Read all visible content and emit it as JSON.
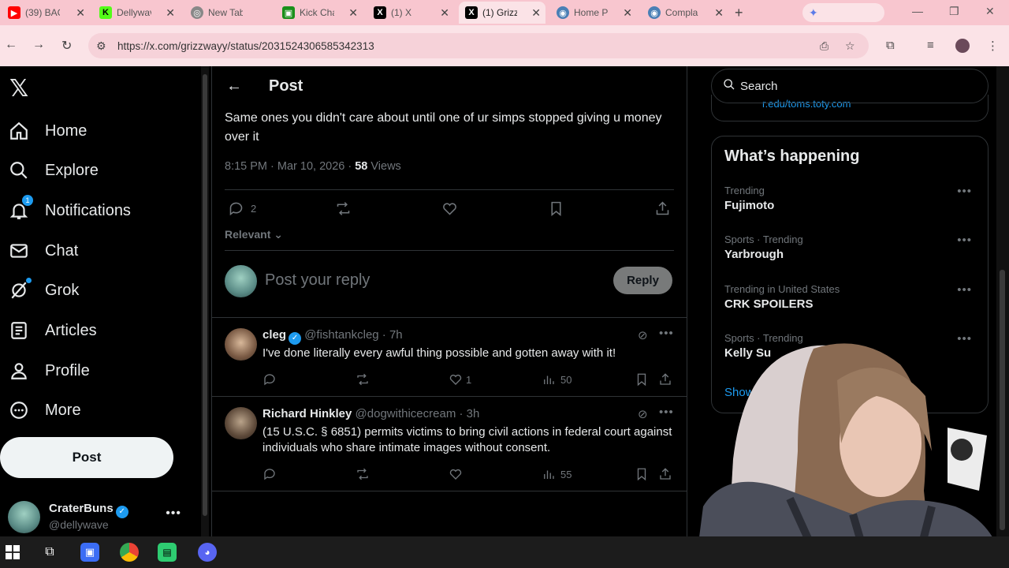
{
  "browser": {
    "tabs": [
      {
        "title": "(39) BAG",
        "color": "#ff0000",
        "glyph": "▶",
        "icon": "youtube-icon"
      },
      {
        "title": "Dellywave",
        "color": "#53fc18",
        "glyph": "K",
        "icon": "kick-icon"
      },
      {
        "title": "New Tab",
        "color": "#888888",
        "glyph": "◎",
        "icon": "chrome-icon"
      },
      {
        "title": "Kick Chat",
        "color": "#1a8f1a",
        "glyph": "▣",
        "icon": "kick-chat-icon"
      },
      {
        "title": "(1) X",
        "color": "#000000",
        "glyph": "X",
        "icon": "x-icon"
      },
      {
        "title": "(1) Grizz",
        "color": "#000000",
        "glyph": "X",
        "icon": "x-icon"
      },
      {
        "title": "Home P",
        "color": "#4a7fb5",
        "glyph": "◉",
        "icon": "globe-icon"
      },
      {
        "title": "Compla",
        "color": "#4a7fb5",
        "glyph": "◉",
        "icon": "globe-icon"
      }
    ],
    "url": "https://x.com/grizzwayy/status/2031524306585342313"
  },
  "nav": {
    "items": [
      {
        "label": "Home",
        "icon": "home-icon"
      },
      {
        "label": "Explore",
        "icon": "search-icon"
      },
      {
        "label": "Notifications",
        "icon": "bell-icon",
        "badge": "1"
      },
      {
        "label": "Chat",
        "icon": "mail-icon"
      },
      {
        "label": "Grok",
        "icon": "grok-icon"
      },
      {
        "label": "Articles",
        "icon": "articles-icon"
      },
      {
        "label": "Profile",
        "icon": "profile-icon"
      },
      {
        "label": "More",
        "icon": "more-circle-icon"
      }
    ],
    "post_label": "Post",
    "account": {
      "name": "CraterBuns",
      "handle": "@dellywave"
    }
  },
  "main": {
    "header_title": "Post",
    "post_text": "Same ones you didn't care about until one of ur simps stopped giving u money over it",
    "time": "8:15 PM · Mar 10, 2026 · ",
    "views_count": "58",
    "views_label": " Views",
    "reply_count": "2",
    "sort_label": "Relevant",
    "reply_placeholder": "Post your reply",
    "reply_button": "Reply"
  },
  "replies": [
    {
      "name": "cleg",
      "handle": "@fishtankcleg · 7h",
      "verified": true,
      "text": "I've done literally every awful thing possible and gotten away with it!",
      "likes": "1",
      "views": "50"
    },
    {
      "name": "Richard Hinkley",
      "handle": "@dogwithicecream · 3h",
      "verified": false,
      "text": "(15 U.S.C. § 6851) permits victims to bring civil actions in federal court against individuals who share intimate images without consent.",
      "likes": "",
      "views": "55"
    }
  ],
  "sidebar": {
    "search_placeholder": "Search",
    "top_link": "r.edu/toms.toty.com",
    "heading": "What’s happening",
    "trends": [
      {
        "context": "Trending",
        "name": "Fujimoto"
      },
      {
        "context": "Sports · Trending",
        "name": "Yarbrough"
      },
      {
        "context": "Trending in United States",
        "name": "CRK SPOILERS"
      },
      {
        "context": "Sports · Trending",
        "name": "Kelly Su"
      }
    ],
    "show_more": "Show"
  }
}
